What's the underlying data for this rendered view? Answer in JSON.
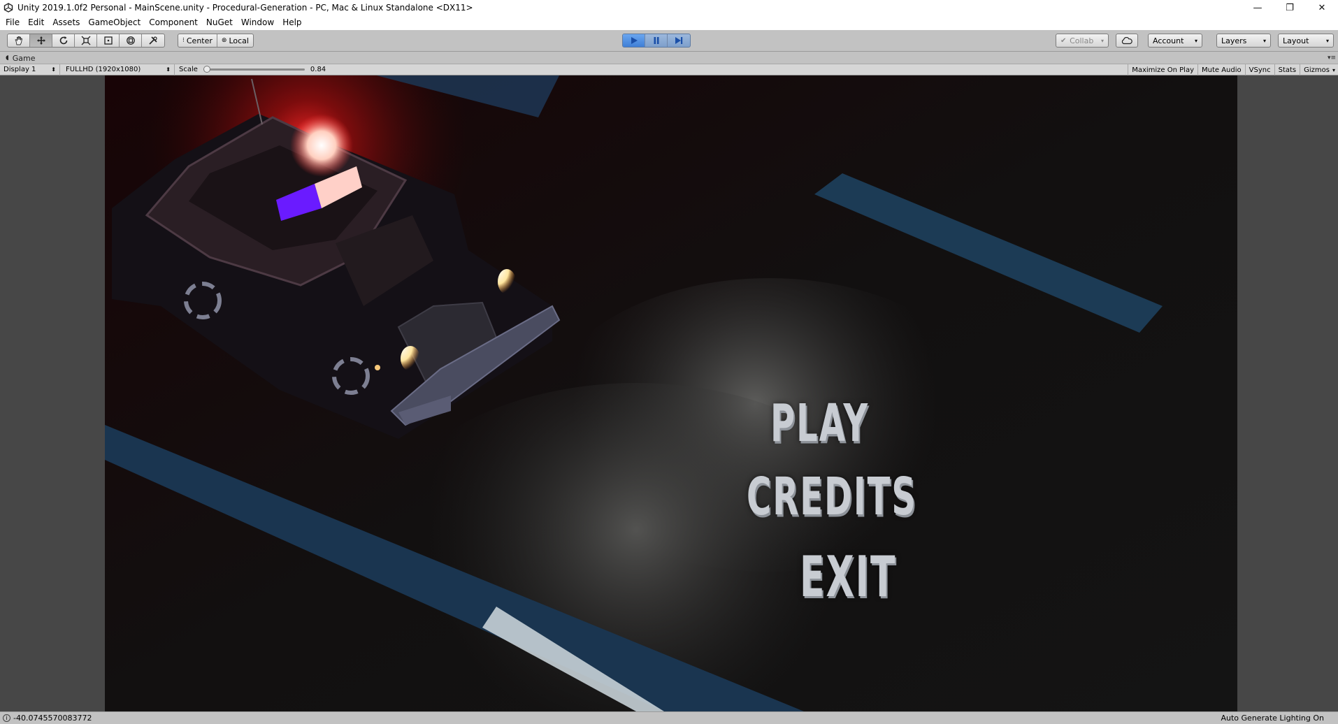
{
  "window": {
    "title": "Unity 2019.1.0f2 Personal - MainScene.unity - Procedural-Generation - PC, Mac & Linux Standalone <DX11>",
    "controls": [
      "—",
      "❐",
      "✕"
    ]
  },
  "menu": [
    "File",
    "Edit",
    "Assets",
    "GameObject",
    "Component",
    "NuGet",
    "Window",
    "Help"
  ],
  "toolbar": {
    "tools": [
      {
        "name": "hand-tool",
        "icon": "hand-icon"
      },
      {
        "name": "move-tool",
        "icon": "move-icon"
      },
      {
        "name": "rotate-tool",
        "icon": "rotate-icon"
      },
      {
        "name": "scale-tool",
        "icon": "scale-icon"
      },
      {
        "name": "rect-tool",
        "icon": "rect-icon"
      },
      {
        "name": "transform-tool",
        "icon": "transform-icon"
      },
      {
        "name": "custom-tool",
        "icon": "custom-tool-icon"
      }
    ],
    "pivot_center": "Center",
    "pivot_local": "Local",
    "collab": "Collab",
    "account": "Account",
    "layers": "Layers",
    "layout": "Layout"
  },
  "game_tab": {
    "label": "Game"
  },
  "game_bar": {
    "display": "Display 1",
    "resolution": "FULLHD (1920x1080)",
    "scale_label": "Scale",
    "scale_value": "0.84",
    "scale_fraction": 0.0,
    "toggles": [
      "Maximize On Play",
      "Mute Audio",
      "VSync",
      "Stats",
      "Gizmos"
    ]
  },
  "game_menu": {
    "play": "PLAY",
    "credits": "CREDITS",
    "exit": "EXIT"
  },
  "status": {
    "message": "-40.0745570083772",
    "right": "Auto Generate Lighting On"
  },
  "colors": {
    "editor_bg": "#c2c2c2",
    "play_accent": "#4f8ee0",
    "siren_red": "#ff2020",
    "siren_blue": "#6a1bff"
  }
}
